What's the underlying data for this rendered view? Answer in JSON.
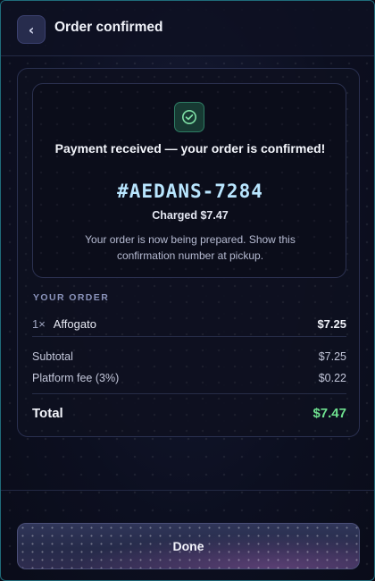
{
  "header": {
    "back_glyph": "‹",
    "title": "Order confirmed"
  },
  "confirmation": {
    "icon": "check-circle-icon",
    "title": "Payment received — your order is confirmed!",
    "order_number": "#AEDANS-7284",
    "charged": "Charged $7.47",
    "description": "Your order is now being prepared. Show this confirmation number at pickup."
  },
  "order": {
    "section_label": "YOUR ORDER",
    "items": [
      {
        "qty": "1×",
        "name": "Affogato",
        "price": "$7.25"
      }
    ],
    "subtotal_label": "Subtotal",
    "subtotal_value": "$7.25",
    "fee_label": "Platform fee (3%)",
    "fee_value": "$0.22",
    "total_label": "Total",
    "total_value": "$7.47"
  },
  "footer": {
    "done_label": "Done"
  },
  "colors": {
    "accent_green": "#6ee08f",
    "order_number": "#b9e6ff",
    "frame_border": "#1f6b7a"
  }
}
